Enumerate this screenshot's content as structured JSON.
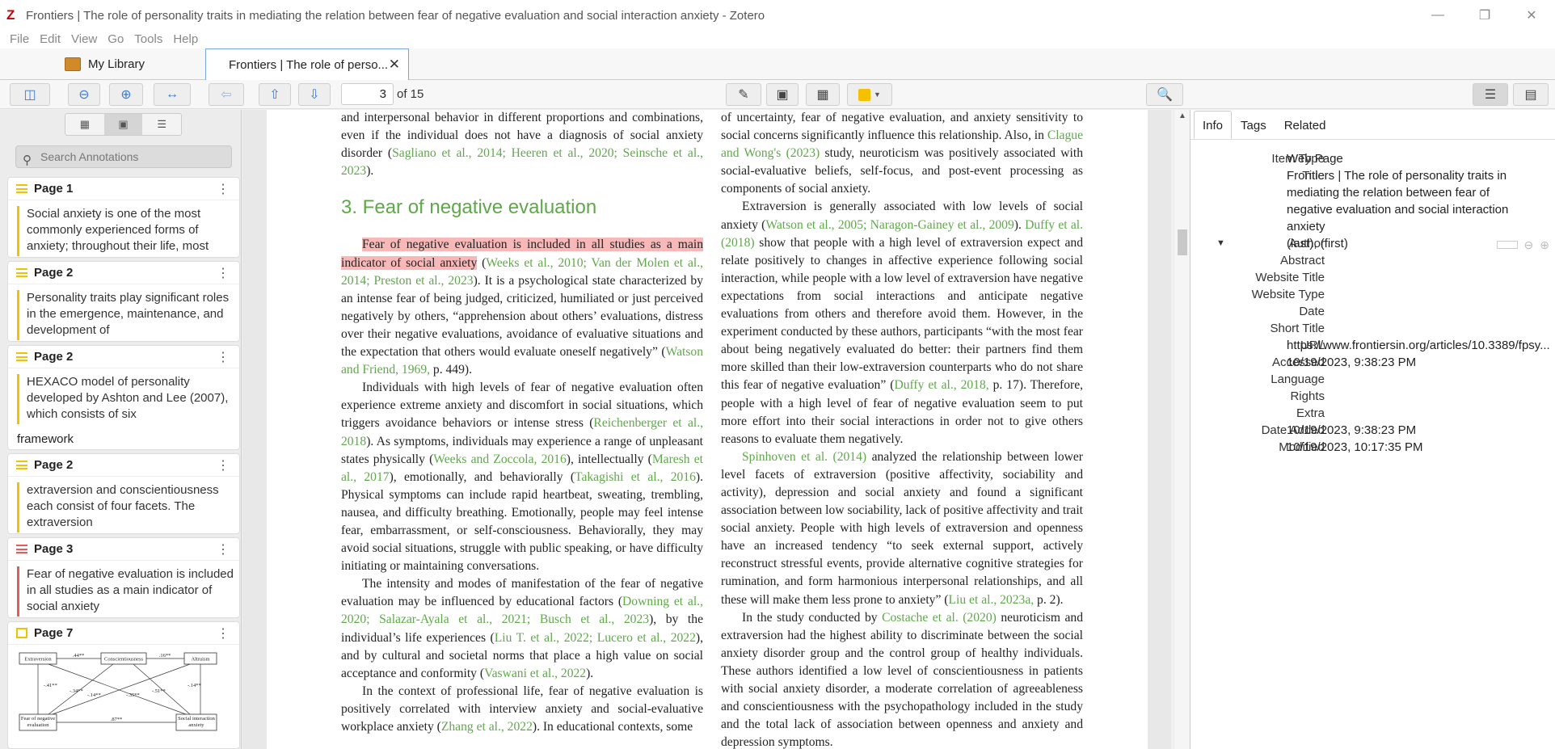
{
  "window": {
    "title": "Frontiers | The role of personality traits in mediating the relation between fear of negative evaluation and social interaction anxiety - Zotero",
    "logo": "Z"
  },
  "menu": [
    "File",
    "Edit",
    "View",
    "Go",
    "Tools",
    "Help"
  ],
  "tabs": {
    "library": "My Library",
    "document": "Frontiers | The role of perso..."
  },
  "toolbar": {
    "page_value": "3",
    "page_of": "of 15",
    "highlight_color": "#f5c000"
  },
  "sidebar": {
    "search_placeholder": "Search Annotations",
    "annotations": [
      {
        "page": "Page 1",
        "color": "#f2c200",
        "text": "Social anxiety is one of the most commonly experienced forms of anxiety; throughout their life, most",
        "comment": ""
      },
      {
        "page": "Page 2",
        "color": "#f2c200",
        "text": "Personality traits play significant roles in the emergence, maintenance, and development of",
        "comment": ""
      },
      {
        "page": "Page 2",
        "color": "#f2c200",
        "text": "HEXACO model of personality developed by Ashton and Lee (2007), which consists of six",
        "comment": "framework"
      },
      {
        "page": "Page 2",
        "color": "#f2c200",
        "text": "extraversion and conscientiousness each consist of four facets. The extraversion",
        "comment": ""
      },
      {
        "page": "Page 3",
        "color": "#e85a5a",
        "text": "Fear of negative evaluation is included in all studies as a main indicator of social anxiety",
        "comment": ""
      },
      {
        "page": "Page 7",
        "color": "#f2c200",
        "text": "",
        "comment": ""
      }
    ],
    "diagram": {
      "nodes": [
        "Extraversion",
        "Conscientiousness",
        "Altruism",
        "Fear of negative evaluation",
        "Social interaction anxiety"
      ],
      "coefs": [
        ".44**",
        ".16**",
        "-.41**",
        "-.34**",
        "-.14**",
        "-.35**",
        "-.51**",
        "-.14**",
        ".87**"
      ]
    }
  },
  "pdf": {
    "left": {
      "p0": "and interpersonal behavior in different proportions and combinations, even if the individual does not have a diagnosis of social anxiety disorder (",
      "p0_ref": "Sagliano et al., 2014; Heeren et al., 2020; Seinsche et al., 2023",
      "p0_end": ").",
      "heading": "3. Fear of negative evaluation",
      "p1_hl": "Fear of negative evaluation is included in all studies as a main indicator of social anxiety",
      "p1_a": " (",
      "p1_ref1": "Weeks et al., 2010; Van der Molen et al., 2014; Preston et al., 2023",
      "p1_b": "). It is a psychological state characterized by an intense fear of being judged, criticized, humiliated or just perceived negatively by others, “apprehension about others’ evaluations, distress over their negative evaluations, avoidance of evaluative situations and the expectation that others would evaluate oneself negatively” (",
      "p1_ref2": "Watson and Friend, 1969,",
      "p1_c": " p. 449).",
      "p2_a": "Individuals with high levels of fear of negative evaluation often experience extreme anxiety and discomfort in social situations, which triggers avoidance behaviors or intense stress (",
      "p2_ref1": "Reichenberger et al., 2018",
      "p2_b": "). As symptoms, individuals may experience a range of unpleasant states physically (",
      "p2_ref2": "Weeks and Zoccola, 2016",
      "p2_c": "), intellectually (",
      "p2_ref3": "Maresh et al., 2017",
      "p2_d": "), emotionally, and behaviorally (",
      "p2_ref4": "Takagishi et al., 2016",
      "p2_e": "). Physical symptoms can include rapid heartbeat, sweating, trembling, nausea, and difficulty breathing. Emotionally, people may feel intense fear, embarrassment, or self-consciousness. Behaviorally, they may avoid social situations, struggle with public speaking, or have difficulty initiating or maintaining conversations.",
      "p3_a": "The intensity and modes of manifestation of the fear of negative evaluation may be influenced by educational factors (",
      "p3_ref1": "Downing et al., 2020; Salazar-Ayala et al., 2021; Busch et al., 2023",
      "p3_b": "), by the individual’s life experiences (",
      "p3_ref2": "Liu T. et al., 2022; Lucero et al., 2022",
      "p3_c": "), and by cultural and societal norms that place a high value on social acceptance and conformity (",
      "p3_ref3": "Vaswani et al., 2022",
      "p3_d": ").",
      "p4_a": "In the context of professional life, fear of negative evaluation is positively correlated with interview anxiety and social-evaluative workplace anxiety (",
      "p4_ref1": "Zhang et al., 2022",
      "p4_b": "). In educational contexts, some"
    },
    "right": {
      "p0_a": "of uncertainty, fear of negative evaluation, and anxiety sensitivity to social concerns significantly influence this relationship. Also, in ",
      "p0_ref": "Clague and Wong's (2023)",
      "p0_b": " study, neuroticism was positively associated with social-evaluative beliefs, self-focus, and post-event processing as components of social anxiety.",
      "p1_a": "Extraversion is generally associated with low levels of social anxiety (",
      "p1_ref1": "Watson et al., 2005; Naragon-Gainey et al., 2009",
      "p1_b": "). ",
      "p1_ref2": "Duffy et al. (2018)",
      "p1_c": " show that people with a high level of extraversion expect and relate positively to changes in affective experience following social interaction, while people with a low level of extraversion have negative expectations from social interactions and anticipate negative evaluations from others and therefore avoid them. However, in the experiment conducted by these authors, participants “with the most fear about being negatively evaluated do better: their partners find them more skilled than their low-extraversion counterparts who do not share this fear of negative evaluation” (",
      "p1_ref3": "Duffy et al., 2018,",
      "p1_d": " p. 17). Therefore, people with a high level of fear of negative evaluation seem to put more effort into their social interactions in order not to give others reasons to evaluate them negatively.",
      "p2_ref": "Spinhoven et al. (2014)",
      "p2_a": " analyzed the relationship between lower level facets of extraversion (positive affectivity, sociability and activity), depression and social anxiety and found a significant association between low sociability, lack of positive affectivity and trait social anxiety. People with high levels of extraversion and openness have an increased tendency “to seek external support, actively reconstruct stressful events, provide alternative cognitive strategies for rumination, and form harmonious interpersonal relationships, and all these will make them less prone to anxiety” (",
      "p2_ref2": "Liu et al., 2023a,",
      "p2_b": " p. 2).",
      "p3_a": "In the study conducted by ",
      "p3_ref": "Costache et al. (2020)",
      "p3_b": " neuroticism and extraversion had the highest ability to discriminate between the social anxiety disorder group and the control group of healthy individuals. These authors identified a low level of conscientiousness in patients with social anxiety disorder, a moderate correlation of agreeableness and conscientiousness with the psychopathology included in the study and the total lack of association between openness and anxiety and depression symptoms."
    }
  },
  "info": {
    "tabs": [
      "Info",
      "Tags",
      "Related"
    ],
    "item_type_label": "Item Type",
    "item_type": "Web Page",
    "title_label": "Title",
    "title": "Frontiers | The role of personality traits in mediating the relation between fear of negative evaluation and social interaction anxiety",
    "author_label": "Author",
    "author": "(last), (first)",
    "abstract_label": "Abstract",
    "website_title_label": "Website Title",
    "website_type_label": "Website Type",
    "date_label": "Date",
    "short_title_label": "Short Title",
    "url_label": "URL",
    "url": "https://www.frontiersin.org/articles/10.3389/fpsy...",
    "accessed_label": "Accessed",
    "accessed": "10/19/2023, 9:38:23 PM",
    "language_label": "Language",
    "rights_label": "Rights",
    "extra_label": "Extra",
    "date_added_label": "Date Added",
    "date_added": "10/19/2023, 9:38:23 PM",
    "modified_label": "Modified",
    "modified": "10/19/2023, 10:17:35 PM"
  }
}
